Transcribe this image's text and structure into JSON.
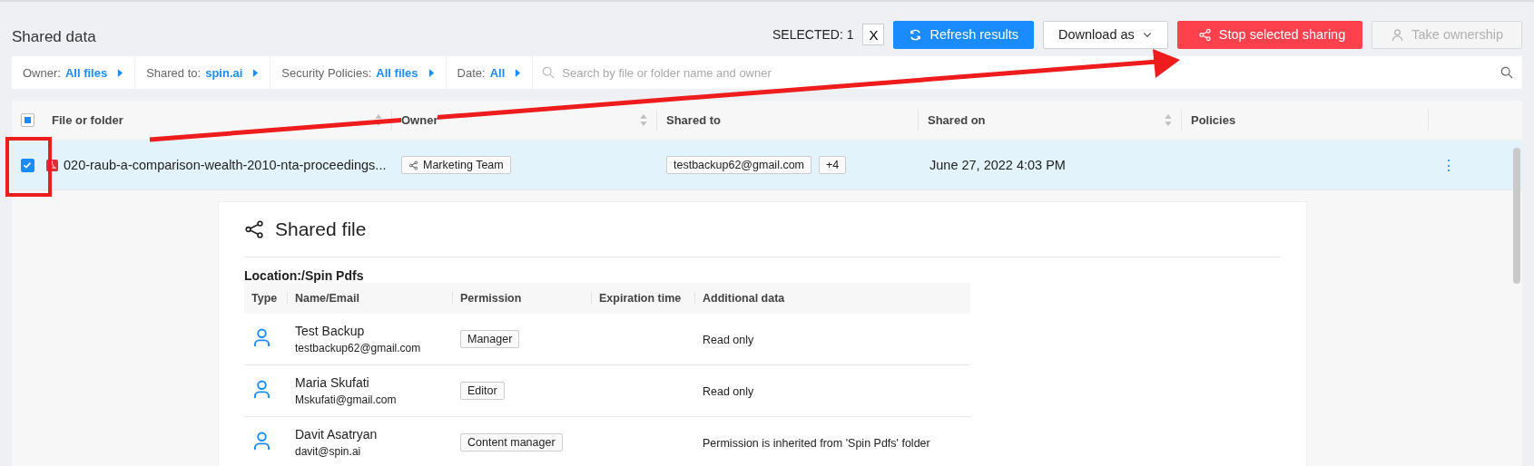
{
  "header": {
    "title": "Shared data",
    "selected_label": "SELECTED: 1",
    "clear_label": "X",
    "buttons": [
      {
        "kind": "primary",
        "label": "Refresh results",
        "disabled": false
      },
      {
        "kind": "dropdown",
        "label": "Download as",
        "disabled": false
      },
      {
        "kind": "danger",
        "label": "Stop selected sharing",
        "disabled": false
      },
      {
        "kind": "owner",
        "label": "Take ownership",
        "disabled": true
      }
    ]
  },
  "filters": [
    {
      "label": "Owner:",
      "value": "All files"
    },
    {
      "label": "Shared to:",
      "value": "spin.ai"
    },
    {
      "label": "Security Policies:",
      "value": "All files"
    },
    {
      "label": "Date:",
      "value": "All"
    }
  ],
  "search": {
    "placeholder": "Search by file or folder name and owner"
  },
  "table": {
    "select_all_partial": true,
    "columns": [
      {
        "label": "File or folder",
        "sortable": true
      },
      {
        "label": "Owner",
        "sortable": true
      },
      {
        "label": "Shared to",
        "sortable": false
      },
      {
        "label": "Shared on",
        "sortable": true
      },
      {
        "label": "Policies",
        "sortable": false
      }
    ],
    "rows": [
      {
        "selected": true,
        "file": "020-raub-a-comparison-wealth-2010-nta-proceedings...",
        "owner": "Marketing Team",
        "shared_to": "testbackup62@gmail.com",
        "shared_more": "+4",
        "shared_on": "June 27, 2022 4:03 PM",
        "menu": "⋮"
      }
    ]
  },
  "details": {
    "title": "Shared file",
    "location": "Location:/Spin Pdfs",
    "columns": [
      "Type",
      "Name/Email",
      "Permission",
      "Expiration time",
      "Additional data"
    ],
    "rows": [
      {
        "name": "Test Backup",
        "email": "testbackup62@gmail.com",
        "permission": "Manager",
        "additional": "Read only"
      },
      {
        "name": "Maria Skufati",
        "email": "Mskufati@gmail.com",
        "permission": "Editor",
        "additional": "Read only"
      },
      {
        "name": "Davit Asatryan",
        "email": "davit@spin.ai",
        "permission": "Content manager",
        "additional": "Permission is inherited from 'Spin Pdfs' folder"
      }
    ]
  }
}
